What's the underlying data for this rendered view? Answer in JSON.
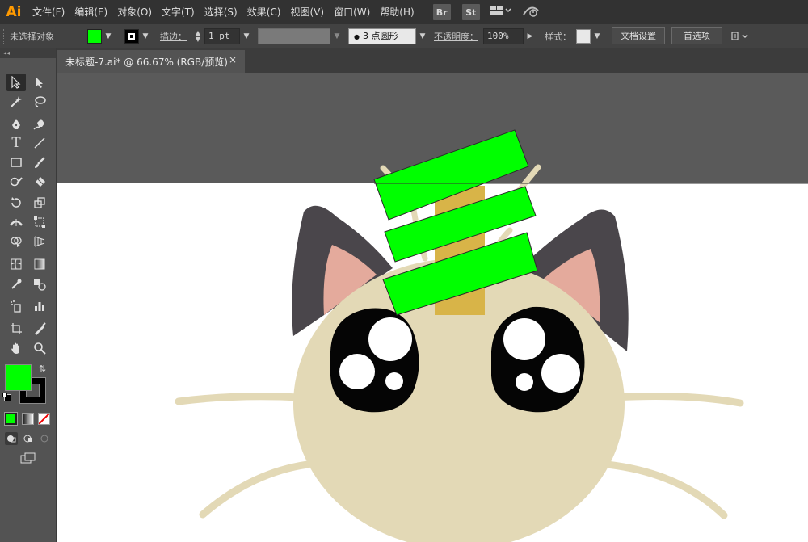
{
  "app": {
    "logo": "Ai"
  },
  "menu": [
    "文件(F)",
    "编辑(E)",
    "对象(O)",
    "文字(T)",
    "选择(S)",
    "效果(C)",
    "视图(V)",
    "窗口(W)",
    "帮助(H)"
  ],
  "app_buttons": [
    "Br",
    "St"
  ],
  "controlbar": {
    "selection_status": "未选择对象",
    "fill_color": "#00ff00",
    "stroke_label": "描边：",
    "stroke_weight": "1 pt",
    "brush_value": "3 点圆形",
    "opacity_label": "不透明度：",
    "opacity_value": "100%",
    "style_label": "样式：",
    "doc_setup_button": "文档设置",
    "preferences_button": "首选项"
  },
  "document_tab": {
    "title": "未标题-7.ai* @ 66.67% (RGB/预览)",
    "close_glyph": "×"
  },
  "toolbox": {
    "fill_color": "#00ff00",
    "stroke_color": "#000000"
  },
  "colors": {
    "accent_green": "#00ff00",
    "cat_face": "#e3d9b6",
    "cat_ears": "#4a464b",
    "inner_ear": "#e4aa9c",
    "charm": "#d8b448"
  }
}
